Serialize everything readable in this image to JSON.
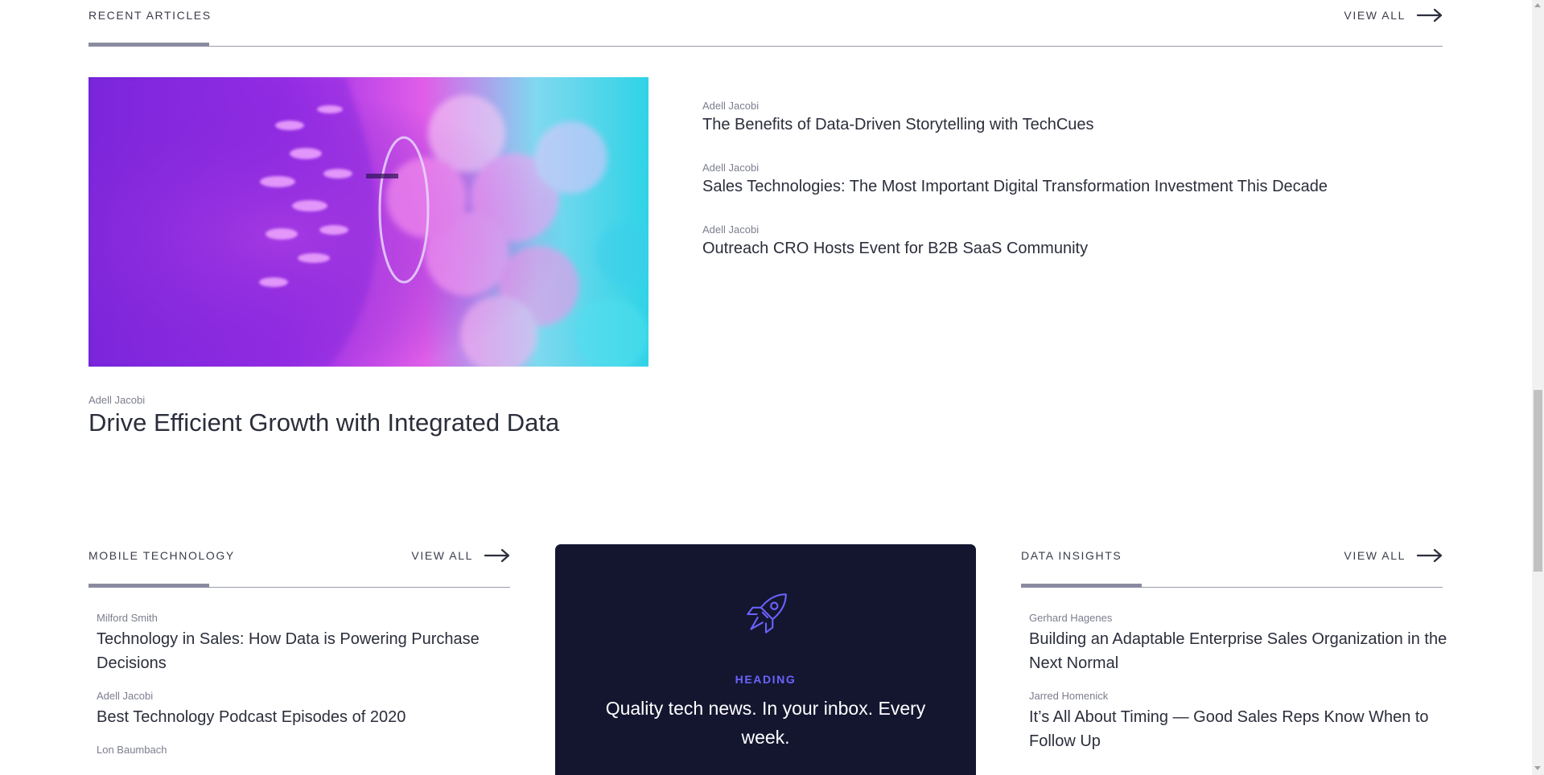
{
  "recent": {
    "title": "RECENT ARTICLES",
    "view_all": "VIEW ALL",
    "featured": {
      "author": "Adell Jacobi",
      "title": "Drive Efficient Growth with Integrated Data"
    },
    "items": [
      {
        "author": "Adell Jacobi",
        "title": "The Benefits of Data-Driven Storytelling with TechCues"
      },
      {
        "author": "Adell Jacobi",
        "title": "Sales Technologies: The Most Important Digital Transformation Investment This Decade"
      },
      {
        "author": "Adell Jacobi",
        "title": "Outreach CRO Hosts Event for B2B SaaS Community"
      }
    ]
  },
  "mobile": {
    "title": "MOBILE TECHNOLOGY",
    "view_all": "VIEW ALL",
    "items": [
      {
        "author": "Milford Smith",
        "title": "Technology in Sales: How Data is Powering Purchase Decisions"
      },
      {
        "author": "Adell Jacobi",
        "title": "Best Technology Podcast Episodes of 2020"
      },
      {
        "author": "Lon Baumbach",
        "title": ""
      }
    ]
  },
  "newsletter": {
    "icon": "rocket-icon",
    "kicker": "HEADING",
    "heading": "Quality tech news. In your inbox. Every week."
  },
  "insights": {
    "title": "DATA INSIGHTS",
    "view_all": "VIEW ALL",
    "items": [
      {
        "author": "Gerhard Hagenes",
        "title": "Building an Adaptable Enterprise Sales Organization in the Next Normal"
      },
      {
        "author": "Jarred Homenick",
        "title": "It’s All About Timing — Good Sales Reps Know When to Follow Up"
      }
    ]
  },
  "colors": {
    "card_background": "#141630",
    "accent": "#6b63ff",
    "text": "#2b2e3b",
    "muted": "#7b7e8e"
  }
}
